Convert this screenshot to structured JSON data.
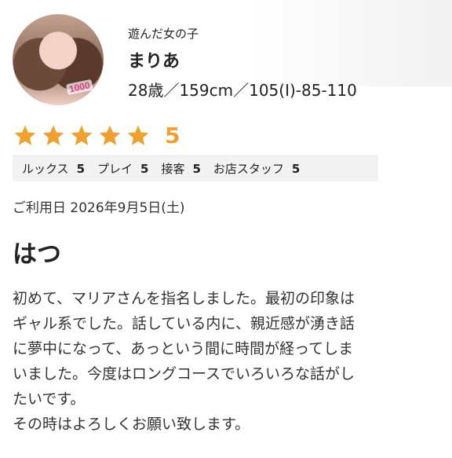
{
  "profile": {
    "subtitle": "遊んだ女の子",
    "name": "まりあ",
    "stats": "28歳／159cm／105(I)-85-110",
    "avatar_badge": "1000"
  },
  "rating": {
    "stars": 5,
    "score": "5",
    "items": [
      {
        "label": "ルックス",
        "value": "5"
      },
      {
        "label": "プレイ",
        "value": "5"
      },
      {
        "label": "接客",
        "value": "5"
      },
      {
        "label": "お店スタッフ",
        "value": "5"
      }
    ],
    "star_color": "#f0a030"
  },
  "review": {
    "date": "ご利用日 2026年9月5日(土)",
    "title": "はつ",
    "body_lines": [
      "初めて、マリアさんを指名しました。最初の印象は",
      "ギャル系でした。話している内に、親近感が湧き話",
      "に夢中になって、あっという間に時間が経ってしま",
      "いました。今度はロングコースでいろいろな話がし",
      "たいです。",
      "その時はよろしくお願い致します。"
    ]
  }
}
